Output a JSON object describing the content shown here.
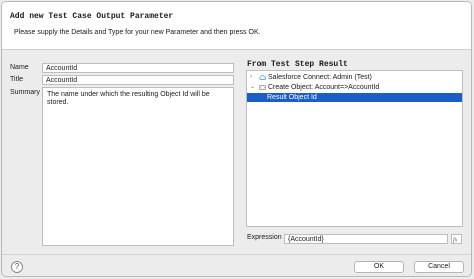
{
  "dialog": {
    "title": "Add new Test Case Output Parameter",
    "subtitle": "Please supply the Details and Type for your new Parameter and then press OK."
  },
  "form": {
    "name_label": "Name",
    "name_value": "AccountId",
    "title_label": "Title",
    "title_value": "AccountId",
    "summary_label": "Summary",
    "summary_value": "The name under which the resulting Object Id will be stored."
  },
  "source": {
    "heading": "From Test Step Result",
    "items": [
      {
        "label": "Salesforce Connect: Admin (Test)",
        "icon": "cloud-icon",
        "expander": "›"
      },
      {
        "label": "Create Object: Account=>AccountId",
        "icon": "object-icon",
        "expander": "⌄"
      },
      {
        "label": "Result Object Id",
        "icon": "",
        "expander": ""
      }
    ]
  },
  "expression": {
    "label": "Expression",
    "value": "{AccountId}"
  },
  "footer": {
    "help_label": "?",
    "ok_label": "OK",
    "cancel_label": "Cancel"
  },
  "colors": {
    "selection": "#1c5dc8",
    "cloud_icon": "#3a8fd8"
  }
}
